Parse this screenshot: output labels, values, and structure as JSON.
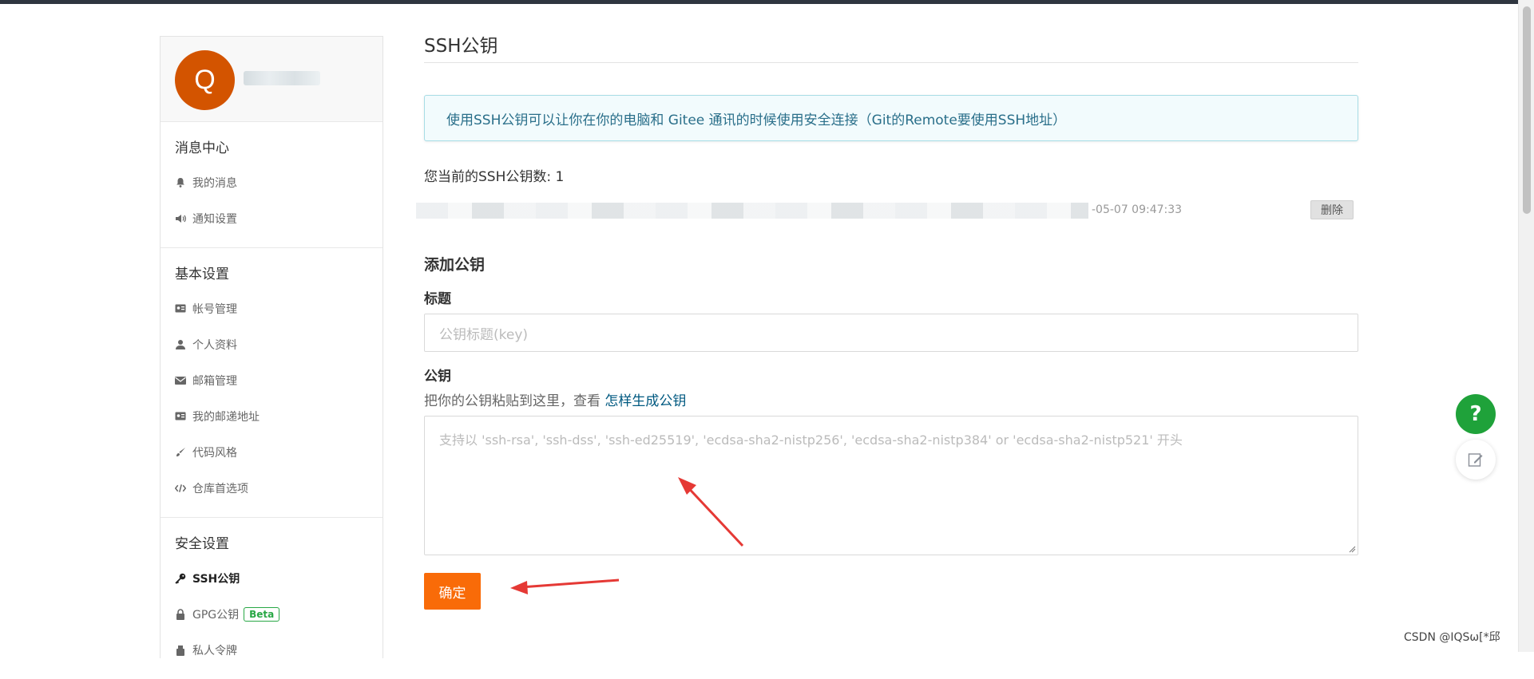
{
  "sidebar": {
    "avatar_letter": "Q",
    "sections": [
      {
        "title": "消息中心",
        "items": [
          "我的消息",
          "通知设置"
        ]
      },
      {
        "title": "基本设置",
        "items": [
          "帐号管理",
          "个人资料",
          "邮箱管理",
          "我的邮递地址",
          "代码风格",
          "仓库首选项"
        ]
      },
      {
        "title": "安全设置",
        "items": [
          "SSH公钥",
          "GPG公钥",
          "私人令牌"
        ]
      }
    ],
    "beta_badge": "Beta"
  },
  "main": {
    "title": "SSH公钥",
    "info": "使用SSH公钥可以让你在你的电脑和 Gitee 通讯的时候使用安全连接（Git的Remote要使用SSH地址）",
    "count_label": "您当前的SSH公钥数: 1",
    "key_date": "-05-07 09:47:33",
    "delete_label": "删除",
    "add_title": "添加公钥",
    "title_label": "标题",
    "title_placeholder": "公钥标题(key)",
    "key_label": "公钥",
    "hint_text": "把你的公钥粘贴到这里，查看 ",
    "hint_link": "怎样生成公钥",
    "key_placeholder": "支持以 'ssh-rsa', 'ssh-dss', 'ssh-ed25519', 'ecdsa-sha2-nistp256', 'ecdsa-sha2-nistp384' or 'ecdsa-sha2-nistp521' 开头",
    "confirm_label": "确定"
  },
  "floating": {
    "help": "?"
  },
  "watermark": "CSDN @IQSω[*邱",
  "colors": {
    "accent": "#f96b08",
    "help": "#1fa23a",
    "avatar": "#d35400",
    "arrow": "#e53935"
  }
}
